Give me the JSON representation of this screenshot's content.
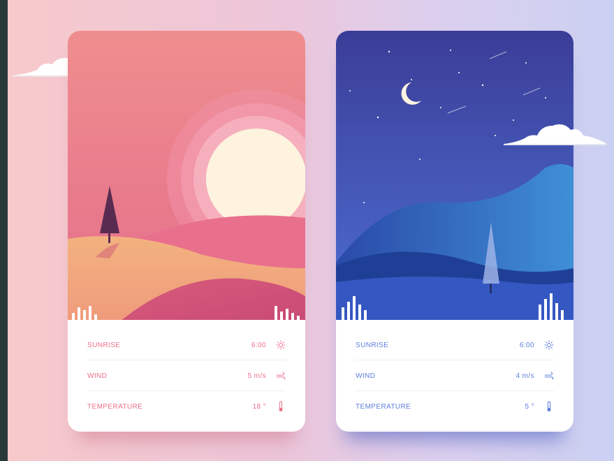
{
  "cards": [
    {
      "theme": "day",
      "rows": [
        {
          "label": "SUNRISE",
          "value": "6:00",
          "icon": "sun-icon"
        },
        {
          "label": "WIND",
          "value": "5 m/s",
          "icon": "wind-icon"
        },
        {
          "label": "TEMPERATURE",
          "value": "18 °",
          "icon": "thermometer-icon"
        }
      ],
      "colors": {
        "accent": "#ec6f8a",
        "sky_top": "#ee8f92",
        "sky_bottom": "#e56b8a",
        "sun": "#fdf3df"
      }
    },
    {
      "theme": "night",
      "rows": [
        {
          "label": "SUNRISE",
          "value": "6:00",
          "icon": "sun-icon"
        },
        {
          "label": "WIND",
          "value": "4 m/s",
          "icon": "wind-icon"
        },
        {
          "label": "TEMPERATURE",
          "value": "5 °",
          "icon": "thermometer-icon"
        }
      ],
      "colors": {
        "accent": "#5d7fdc",
        "sky_top": "#3c3f99",
        "sky_bottom": "#4a6ad0",
        "moon": "#fff4e2"
      }
    }
  ]
}
